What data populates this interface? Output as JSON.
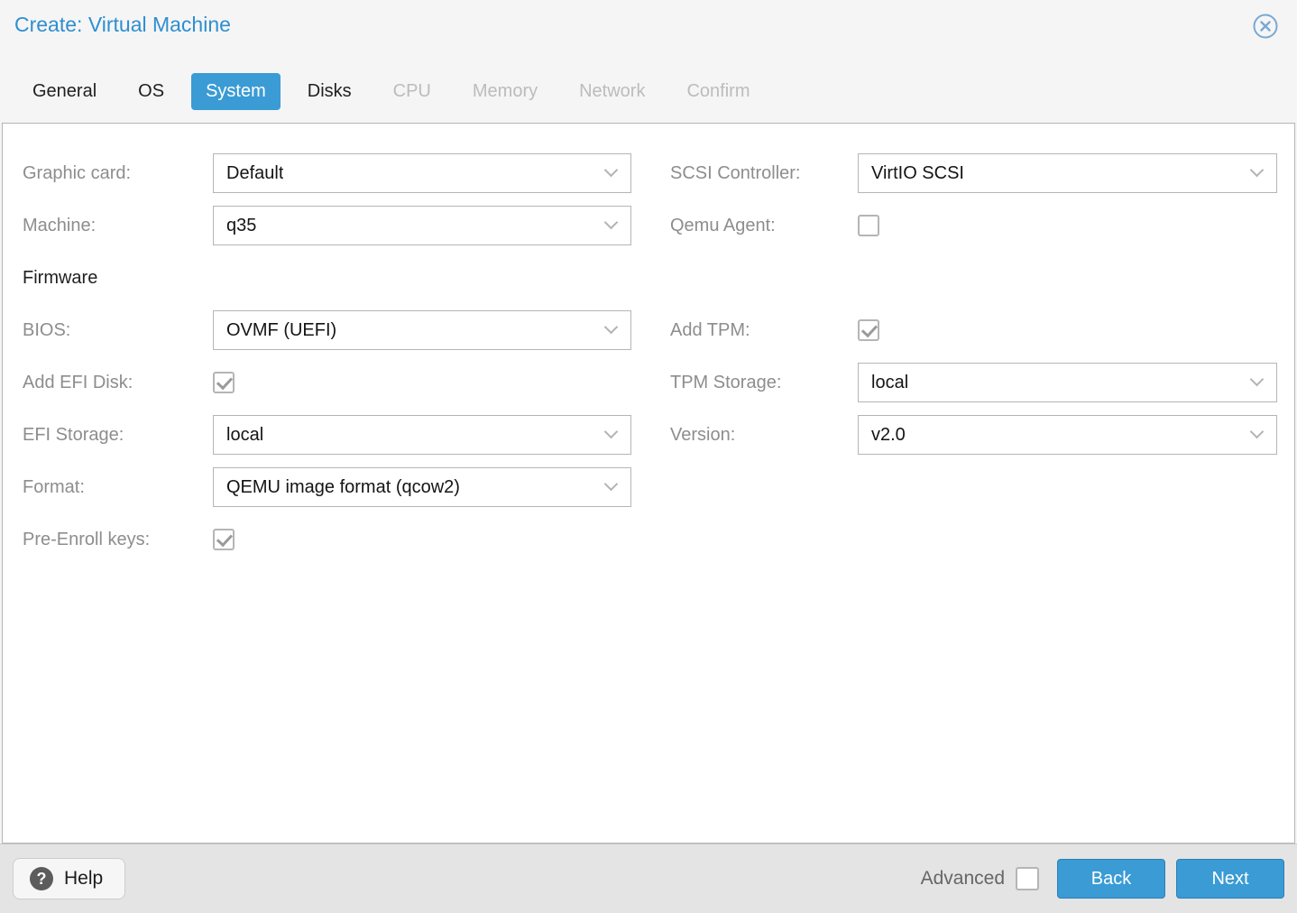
{
  "colors": {
    "accent": "#3a9bd5",
    "accent_border": "#2f7fb6",
    "title_blue": "#2e8fd0",
    "label_gray": "#8d8d8d",
    "border_gray": "#b5b5b5",
    "tab_disabled": "#bcbcbc",
    "text_dark": "#141414",
    "header_bg": "#f5f5f5",
    "panel_bg": "#ffffff",
    "footer_bg": "#e4e4e4"
  },
  "dialog": {
    "title": "Create: Virtual Machine"
  },
  "icons": {
    "close": "circle-x",
    "help_glyph": "?",
    "chevron": "chevron-down",
    "checkmark": "check"
  },
  "tabs": [
    {
      "label": "General",
      "active": false,
      "disabled": false
    },
    {
      "label": "OS",
      "active": false,
      "disabled": false
    },
    {
      "label": "System",
      "active": true,
      "disabled": false
    },
    {
      "label": "Disks",
      "active": false,
      "disabled": false
    },
    {
      "label": "CPU",
      "active": false,
      "disabled": true
    },
    {
      "label": "Memory",
      "active": false,
      "disabled": true
    },
    {
      "label": "Network",
      "active": false,
      "disabled": true
    },
    {
      "label": "Confirm",
      "active": false,
      "disabled": true
    }
  ],
  "form": {
    "left": [
      {
        "label": "Graphic card:",
        "type": "select",
        "value": "Default"
      },
      {
        "label": "Machine:",
        "type": "select",
        "value": "q35"
      },
      {
        "label": "Firmware",
        "type": "heading"
      },
      {
        "label": "BIOS:",
        "type": "select",
        "value": "OVMF (UEFI)"
      },
      {
        "label": "Add EFI Disk:",
        "type": "checkbox",
        "checked": true
      },
      {
        "label": "EFI Storage:",
        "type": "select",
        "value": "local"
      },
      {
        "label": "Format:",
        "type": "select",
        "value": "QEMU image format (qcow2)"
      },
      {
        "label": "Pre-Enroll keys:",
        "type": "checkbox",
        "checked": true
      }
    ],
    "right": [
      {
        "label": "SCSI Controller:",
        "type": "select",
        "value": "VirtIO SCSI"
      },
      {
        "label": "Qemu Agent:",
        "type": "checkbox",
        "checked": false
      },
      {
        "label": "",
        "type": "spacer"
      },
      {
        "label": "Add TPM:",
        "type": "checkbox",
        "checked": true
      },
      {
        "label": "TPM Storage:",
        "type": "select",
        "value": "local"
      },
      {
        "label": "Version:",
        "type": "select",
        "value": "v2.0"
      }
    ]
  },
  "footer": {
    "help_label": "Help",
    "advanced_label": "Advanced",
    "advanced_checked": false,
    "back_label": "Back",
    "next_label": "Next"
  }
}
